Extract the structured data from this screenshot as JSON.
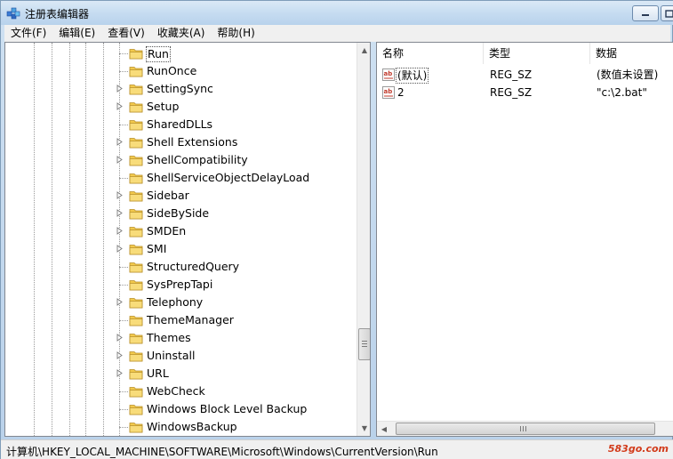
{
  "window": {
    "title": "注册表编辑器"
  },
  "menu": [
    "文件(F)",
    "编辑(E)",
    "查看(V)",
    "收藏夹(A)",
    "帮助(H)"
  ],
  "tree": {
    "items": [
      {
        "label": "Run",
        "expandable": false,
        "selected": true
      },
      {
        "label": "RunOnce",
        "expandable": false,
        "selected": false
      },
      {
        "label": "SettingSync",
        "expandable": true,
        "selected": false
      },
      {
        "label": "Setup",
        "expandable": true,
        "selected": false
      },
      {
        "label": "SharedDLLs",
        "expandable": false,
        "selected": false
      },
      {
        "label": "Shell Extensions",
        "expandable": true,
        "selected": false
      },
      {
        "label": "ShellCompatibility",
        "expandable": true,
        "selected": false
      },
      {
        "label": "ShellServiceObjectDelayLoad",
        "expandable": false,
        "selected": false
      },
      {
        "label": "Sidebar",
        "expandable": true,
        "selected": false
      },
      {
        "label": "SideBySide",
        "expandable": true,
        "selected": false
      },
      {
        "label": "SMDEn",
        "expandable": true,
        "selected": false
      },
      {
        "label": "SMI",
        "expandable": true,
        "selected": false
      },
      {
        "label": "StructuredQuery",
        "expandable": false,
        "selected": false
      },
      {
        "label": "SysPrepTapi",
        "expandable": false,
        "selected": false
      },
      {
        "label": "Telephony",
        "expandable": true,
        "selected": false
      },
      {
        "label": "ThemeManager",
        "expandable": false,
        "selected": false
      },
      {
        "label": "Themes",
        "expandable": true,
        "selected": false
      },
      {
        "label": "Uninstall",
        "expandable": true,
        "selected": false
      },
      {
        "label": "URL",
        "expandable": true,
        "selected": false
      },
      {
        "label": "WebCheck",
        "expandable": false,
        "selected": false
      },
      {
        "label": "Windows Block Level Backup",
        "expandable": false,
        "selected": false
      },
      {
        "label": "WindowsBackup",
        "expandable": false,
        "selected": false
      }
    ],
    "scroll_position_fraction": 0.73
  },
  "values": {
    "columns": [
      "名称",
      "类型",
      "数据"
    ],
    "rows": [
      {
        "name": "(默认)",
        "type": "REG_SZ",
        "data": "(数值未设置)",
        "icon": "string-value-icon"
      },
      {
        "name": "2",
        "type": "REG_SZ",
        "data": "\"c:\\2.bat\"",
        "icon": "string-value-icon"
      }
    ]
  },
  "status": {
    "path": "计算机\\HKEY_LOCAL_MACHINE\\SOFTWARE\\Microsoft\\Windows\\CurrentVersion\\Run",
    "watermark": "583go.com"
  },
  "colors": {
    "folder": "#f2c94c",
    "value_icon_red": "#c0392b",
    "watermark": "#d23b1a"
  }
}
